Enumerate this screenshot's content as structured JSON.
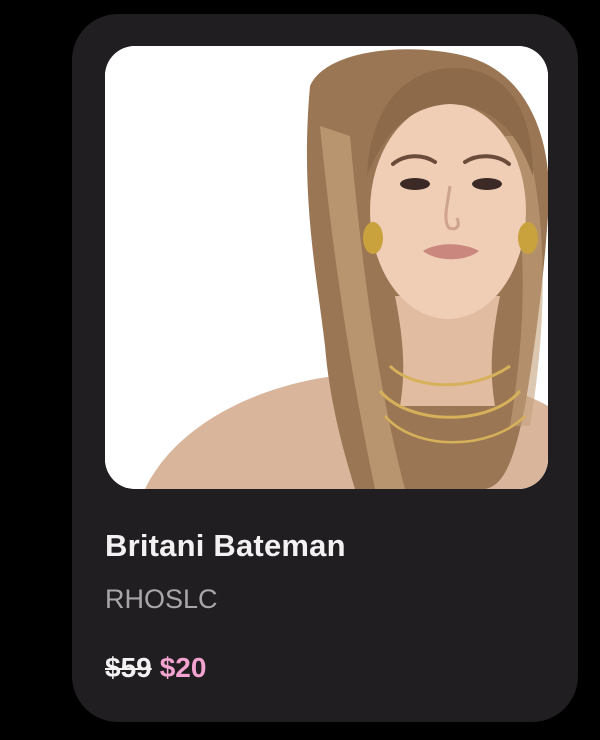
{
  "card": {
    "name": "Britani Bateman",
    "show": "RHOSLC",
    "original_price": "$59",
    "sale_price": "$20"
  },
  "colors": {
    "background": "#000000",
    "card": "#211e21",
    "name_text": "#f4f1f2",
    "subtitle_text": "#a9a6a8",
    "sale_price": "#f3a3cf"
  }
}
